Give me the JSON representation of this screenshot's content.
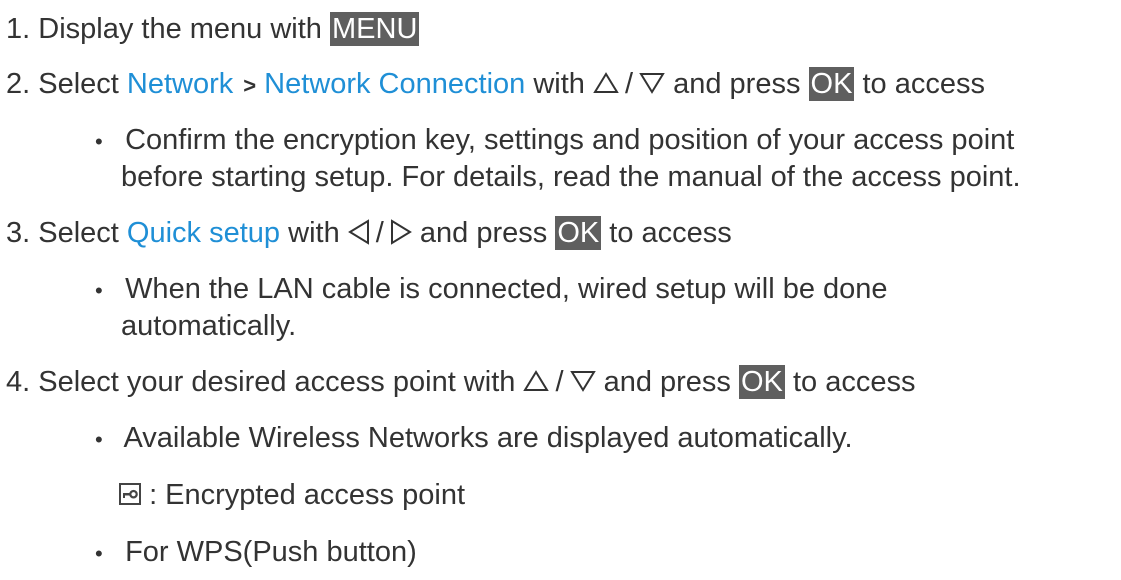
{
  "step1": {
    "number": "1.",
    "text": "Display the menu with",
    "key": "MENU"
  },
  "step2": {
    "number": "2.",
    "text_before": "Select",
    "link1": "Network",
    "separator": ">",
    "link2": "Network Connection",
    "with_text": "with",
    "slash": "/",
    "press_text": "and press",
    "key": "OK",
    "after_key": "to access",
    "bullet": "Confirm the encryption key, settings and position of your access point",
    "bullet_cont": "before starting setup. For details, read the manual of the access point."
  },
  "step3": {
    "number": "3.",
    "text_before": "Select",
    "link": "Quick setup",
    "with_text": "with",
    "slash": "/",
    "press_text": "and press",
    "key": "OK",
    "after_key": "to access",
    "bullet": "When the LAN cable is connected, wired setup will be done",
    "bullet_cont": "automatically."
  },
  "step4": {
    "number": "4.",
    "text": "Select your desired access point with",
    "slash": "/",
    "press_text": "and press",
    "key": "OK",
    "after_key": "to access",
    "bullet1": "Available Wireless Networks are displayed automatically.",
    "encrypted_label": ": Encrypted access point",
    "bullet2": "For WPS(Push button)"
  },
  "icons": {
    "up": "up-triangle-outline-icon",
    "down": "down-triangle-outline-icon",
    "left": "left-triangle-outline-icon",
    "right": "right-triangle-outline-icon",
    "lock": "encrypted-key-icon",
    "bullet": "bullet-dot-icon"
  },
  "colors": {
    "link": "#1f8fd6",
    "key_bg": "#5f5f5f",
    "text": "#333333"
  }
}
